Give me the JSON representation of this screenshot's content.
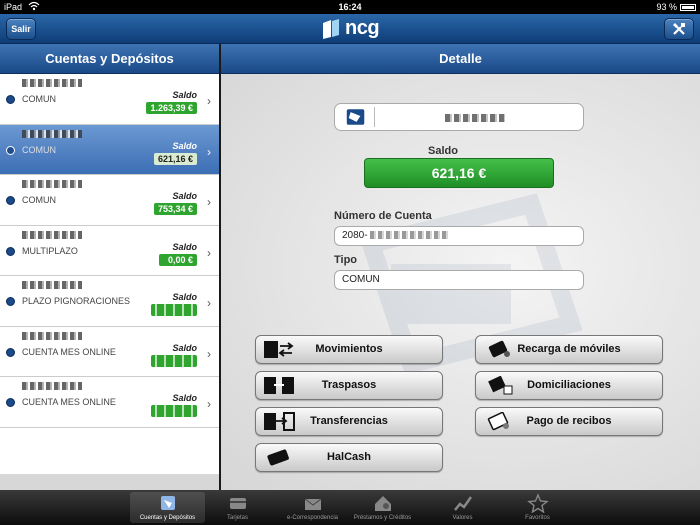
{
  "statusbar": {
    "carrier": "iPad",
    "time": "16:24",
    "battery": "93 %"
  },
  "navbar": {
    "exit_label": "Salir",
    "logo_text": "ncg",
    "settings_icon": "tools-icon"
  },
  "sidebar": {
    "title": "Cuentas y Depósitos",
    "saldo_label": "Saldo",
    "accounts": [
      {
        "type": "COMUN",
        "amount": "1.263,39 €",
        "selected": false
      },
      {
        "type": "COMUN",
        "amount": "621,16 €",
        "selected": true
      },
      {
        "type": "COMUN",
        "amount": "753,34 €",
        "selected": false
      },
      {
        "type": "MULTIPLAZO",
        "amount": "0,00 €",
        "selected": false
      },
      {
        "type": "PLAZO PIGNORACIONES",
        "amount": "",
        "selected": false
      },
      {
        "type": "CUENTA MES ONLINE",
        "amount": "",
        "selected": false
      },
      {
        "type": "CUENTA MES ONLINE",
        "amount": "",
        "selected": false
      }
    ]
  },
  "detail": {
    "title": "Detalle",
    "saldo_label": "Saldo",
    "saldo_value": "621,16 €",
    "cuenta_label": "Número de Cuenta",
    "cuenta_prefix": "2080-",
    "tipo_label": "Tipo",
    "tipo_value": "COMUN",
    "actions_left": [
      "Movimientos",
      "Traspasos",
      "Transferencias",
      "HalCash"
    ],
    "actions_right": [
      "Recarga de móviles",
      "Domiciliaciones",
      "Pago de recibos"
    ]
  },
  "tabbar": {
    "tabs": [
      {
        "label": "Cuentas y Depósitos",
        "icon": "accounts-icon",
        "active": true
      },
      {
        "label": "Tarjetas",
        "icon": "cards-icon",
        "active": false
      },
      {
        "label": "e-Correspondencia",
        "icon": "mail-icon",
        "active": false
      },
      {
        "label": "Préstamos y Créditos",
        "icon": "house-icon",
        "active": false
      },
      {
        "label": "Valores",
        "icon": "chart-icon",
        "active": false
      },
      {
        "label": "Favoritos",
        "icon": "star-icon",
        "active": false
      }
    ]
  },
  "colors": {
    "nav_blue": "#1a4987",
    "saldo_green": "#2fa52f",
    "selected_row": "#4b7dc0"
  }
}
